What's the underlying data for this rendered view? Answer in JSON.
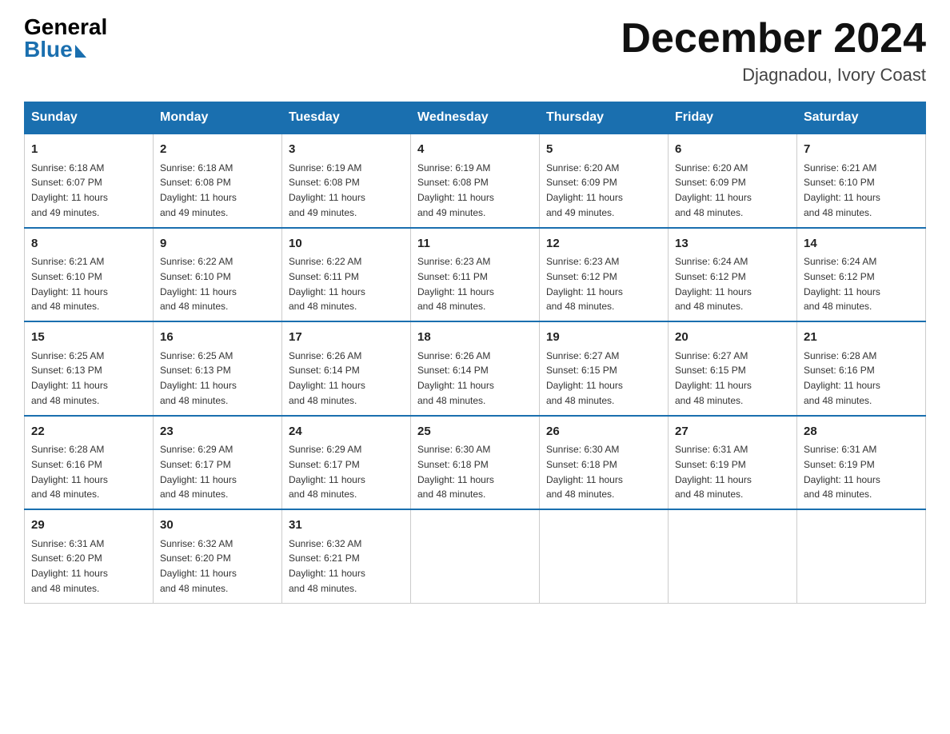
{
  "logo": {
    "general": "General",
    "blue": "Blue"
  },
  "title": "December 2024",
  "subtitle": "Djagnadou, Ivory Coast",
  "days_of_week": [
    "Sunday",
    "Monday",
    "Tuesday",
    "Wednesday",
    "Thursday",
    "Friday",
    "Saturday"
  ],
  "weeks": [
    [
      {
        "day": "1",
        "sunrise": "6:18 AM",
        "sunset": "6:07 PM",
        "daylight": "11 hours and 49 minutes."
      },
      {
        "day": "2",
        "sunrise": "6:18 AM",
        "sunset": "6:08 PM",
        "daylight": "11 hours and 49 minutes."
      },
      {
        "day": "3",
        "sunrise": "6:19 AM",
        "sunset": "6:08 PM",
        "daylight": "11 hours and 49 minutes."
      },
      {
        "day": "4",
        "sunrise": "6:19 AM",
        "sunset": "6:08 PM",
        "daylight": "11 hours and 49 minutes."
      },
      {
        "day": "5",
        "sunrise": "6:20 AM",
        "sunset": "6:09 PM",
        "daylight": "11 hours and 49 minutes."
      },
      {
        "day": "6",
        "sunrise": "6:20 AM",
        "sunset": "6:09 PM",
        "daylight": "11 hours and 48 minutes."
      },
      {
        "day": "7",
        "sunrise": "6:21 AM",
        "sunset": "6:10 PM",
        "daylight": "11 hours and 48 minutes."
      }
    ],
    [
      {
        "day": "8",
        "sunrise": "6:21 AM",
        "sunset": "6:10 PM",
        "daylight": "11 hours and 48 minutes."
      },
      {
        "day": "9",
        "sunrise": "6:22 AM",
        "sunset": "6:10 PM",
        "daylight": "11 hours and 48 minutes."
      },
      {
        "day": "10",
        "sunrise": "6:22 AM",
        "sunset": "6:11 PM",
        "daylight": "11 hours and 48 minutes."
      },
      {
        "day": "11",
        "sunrise": "6:23 AM",
        "sunset": "6:11 PM",
        "daylight": "11 hours and 48 minutes."
      },
      {
        "day": "12",
        "sunrise": "6:23 AM",
        "sunset": "6:12 PM",
        "daylight": "11 hours and 48 minutes."
      },
      {
        "day": "13",
        "sunrise": "6:24 AM",
        "sunset": "6:12 PM",
        "daylight": "11 hours and 48 minutes."
      },
      {
        "day": "14",
        "sunrise": "6:24 AM",
        "sunset": "6:12 PM",
        "daylight": "11 hours and 48 minutes."
      }
    ],
    [
      {
        "day": "15",
        "sunrise": "6:25 AM",
        "sunset": "6:13 PM",
        "daylight": "11 hours and 48 minutes."
      },
      {
        "day": "16",
        "sunrise": "6:25 AM",
        "sunset": "6:13 PM",
        "daylight": "11 hours and 48 minutes."
      },
      {
        "day": "17",
        "sunrise": "6:26 AM",
        "sunset": "6:14 PM",
        "daylight": "11 hours and 48 minutes."
      },
      {
        "day": "18",
        "sunrise": "6:26 AM",
        "sunset": "6:14 PM",
        "daylight": "11 hours and 48 minutes."
      },
      {
        "day": "19",
        "sunrise": "6:27 AM",
        "sunset": "6:15 PM",
        "daylight": "11 hours and 48 minutes."
      },
      {
        "day": "20",
        "sunrise": "6:27 AM",
        "sunset": "6:15 PM",
        "daylight": "11 hours and 48 minutes."
      },
      {
        "day": "21",
        "sunrise": "6:28 AM",
        "sunset": "6:16 PM",
        "daylight": "11 hours and 48 minutes."
      }
    ],
    [
      {
        "day": "22",
        "sunrise": "6:28 AM",
        "sunset": "6:16 PM",
        "daylight": "11 hours and 48 minutes."
      },
      {
        "day": "23",
        "sunrise": "6:29 AM",
        "sunset": "6:17 PM",
        "daylight": "11 hours and 48 minutes."
      },
      {
        "day": "24",
        "sunrise": "6:29 AM",
        "sunset": "6:17 PM",
        "daylight": "11 hours and 48 minutes."
      },
      {
        "day": "25",
        "sunrise": "6:30 AM",
        "sunset": "6:18 PM",
        "daylight": "11 hours and 48 minutes."
      },
      {
        "day": "26",
        "sunrise": "6:30 AM",
        "sunset": "6:18 PM",
        "daylight": "11 hours and 48 minutes."
      },
      {
        "day": "27",
        "sunrise": "6:31 AM",
        "sunset": "6:19 PM",
        "daylight": "11 hours and 48 minutes."
      },
      {
        "day": "28",
        "sunrise": "6:31 AM",
        "sunset": "6:19 PM",
        "daylight": "11 hours and 48 minutes."
      }
    ],
    [
      {
        "day": "29",
        "sunrise": "6:31 AM",
        "sunset": "6:20 PM",
        "daylight": "11 hours and 48 minutes."
      },
      {
        "day": "30",
        "sunrise": "6:32 AM",
        "sunset": "6:20 PM",
        "daylight": "11 hours and 48 minutes."
      },
      {
        "day": "31",
        "sunrise": "6:32 AM",
        "sunset": "6:21 PM",
        "daylight": "11 hours and 48 minutes."
      },
      null,
      null,
      null,
      null
    ]
  ]
}
